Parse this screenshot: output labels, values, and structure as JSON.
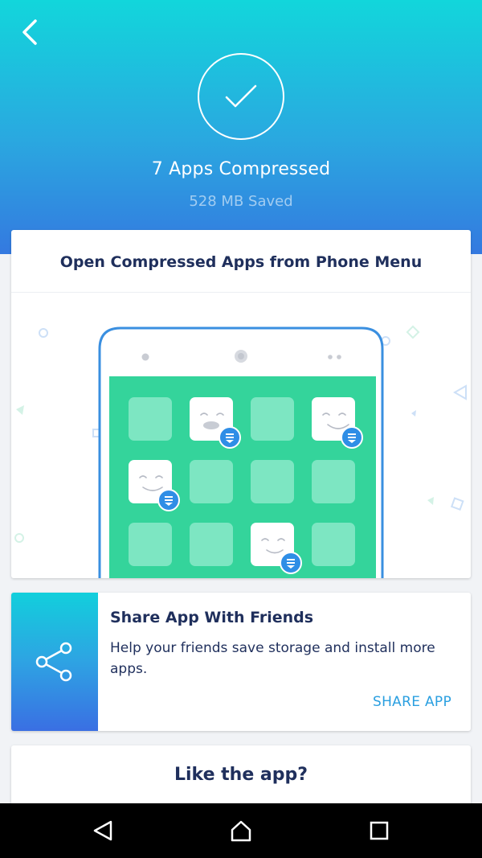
{
  "header": {
    "title": "7 Apps Compressed",
    "subtitle": "528 MB Saved",
    "back_icon": "chevron-left-icon",
    "status_icon": "checkmark-icon"
  },
  "open_card": {
    "title": "Open Compressed Apps from Phone Menu"
  },
  "share_card": {
    "title": "Share App With Friends",
    "description": "Help your friends save storage and install more apps.",
    "button_label": "SHARE APP",
    "icon": "share-icon"
  },
  "like_card": {
    "title": "Like the app?"
  },
  "nav": {
    "back_icon": "triangle-back-icon",
    "home_icon": "home-icon",
    "recents_icon": "square-recents-icon"
  },
  "colors": {
    "header_top": "#12d6db",
    "header_bottom": "#3479e0",
    "text_dark": "#1f2f5c",
    "accent": "#2a9fe0",
    "phone_screen": "#34d49b",
    "badge": "#2f8ee6"
  }
}
